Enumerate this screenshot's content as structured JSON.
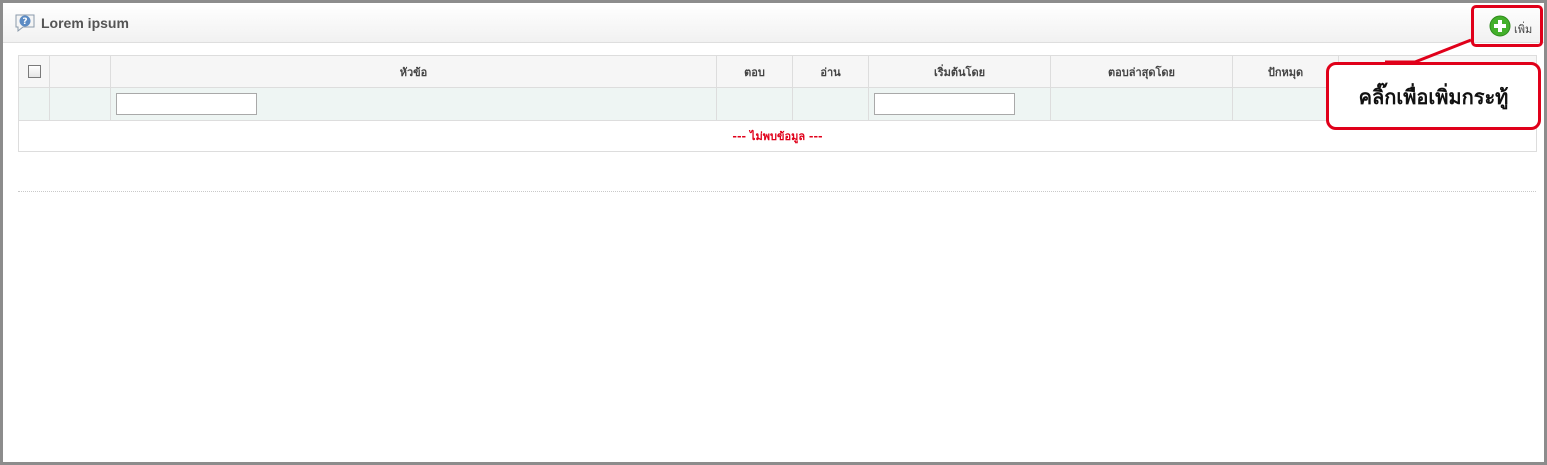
{
  "panel": {
    "title": "Lorem ipsum",
    "add_label": "เพิ่ม"
  },
  "table": {
    "columns": [
      "",
      "",
      "หัวข้อ",
      "ตอบ",
      "อ่าน",
      "เริ่มต้นโดย",
      "ตอบล่าสุดโดย",
      "ปักหมุด",
      ""
    ],
    "empty_message": "--- ไม่พบข้อมูล ---",
    "filters": {
      "topic": "",
      "started_by": ""
    }
  },
  "callout": {
    "text": "คลิ๊กเพื่อเพิ่มกระทู้"
  },
  "colors": {
    "highlight": "#e0001a",
    "add_icon": "#43b02a",
    "filter_row": "#eef5f3"
  },
  "icons": {
    "title": "help-question-icon",
    "add": "plus-circle-icon"
  }
}
